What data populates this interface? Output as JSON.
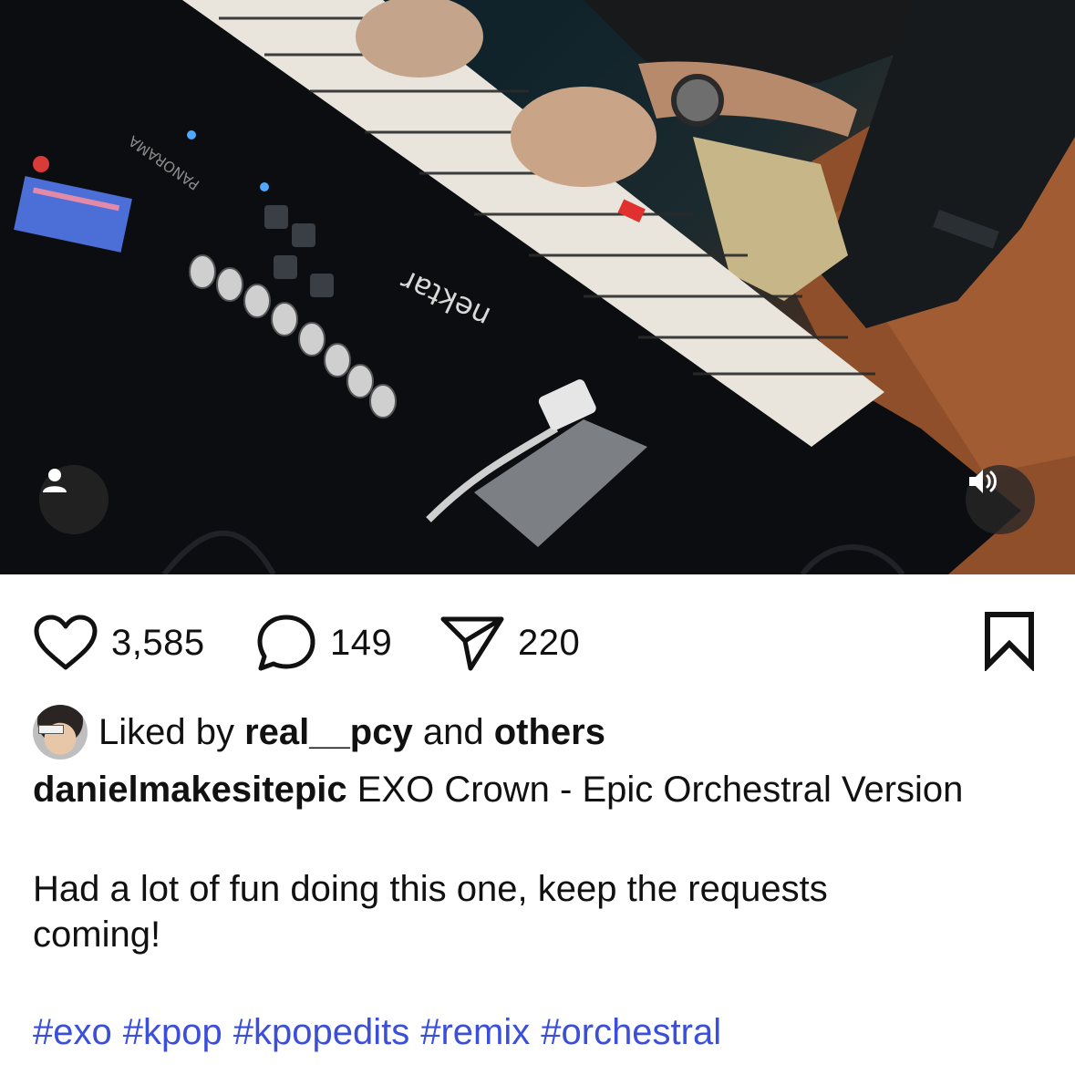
{
  "post": {
    "likes_count": "3,585",
    "comments_count": "149",
    "shares_count": "220",
    "liked_by_prefix": "Liked by",
    "liked_by_user": "real__pcy",
    "liked_by_connector": "and",
    "liked_by_suffix": "others",
    "author": "danielmakesitepic",
    "caption_title": "EXO Crown - Epic Orchestral Version",
    "caption_body": "Had a lot of fun doing this one, keep the requests coming!",
    "hashtags": [
      "#exo",
      "#kpop",
      "#kpopedits",
      "#remix",
      "#orchestral"
    ]
  },
  "media": {
    "keyboard_brand_text": "nektar",
    "controller_label_text": "PANORAMA",
    "user_tag_icon": "user-icon",
    "sound_icon": "speaker-on-icon"
  },
  "icons": {
    "like": "heart-outline-icon",
    "comment": "comment-bubble-icon",
    "share": "paper-plane-icon",
    "save": "bookmark-outline-icon"
  },
  "colors": {
    "hashtag": "#3b4fd8",
    "text": "#111111",
    "media_button_bg": "rgba(40,40,40,0.78)"
  }
}
